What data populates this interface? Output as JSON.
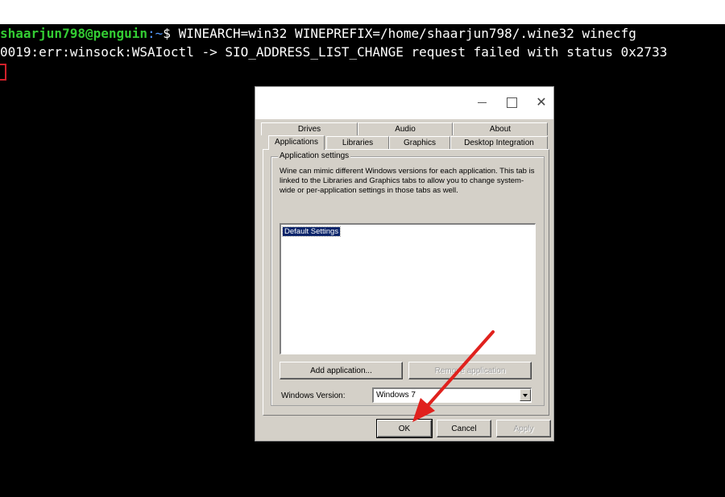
{
  "terminal": {
    "prompt_user": "shaarjun798@penguin",
    "prompt_path": ":~",
    "prompt_symbol": "$ ",
    "command": "WINEARCH=win32 WINEPREFIX=/home/shaarjun798/.wine32 winecfg",
    "output_line": "0019:err:winsock:WSAIoctl -> SIO_ADDRESS_LIST_CHANGE request failed with status 0x2733"
  },
  "dialog": {
    "tabs_row1": [
      "Drives",
      "Audio",
      "About"
    ],
    "tabs_row2": [
      "Applications",
      "Libraries",
      "Graphics",
      "Desktop Integration"
    ],
    "group_title": "Application settings",
    "description": "Wine can mimic different Windows versions for each application. This tab is linked to the Libraries and Graphics tabs to allow you to change system-wide or per-application settings in those tabs as well.",
    "list_items": [
      "Default Settings"
    ],
    "add_button": "Add application...",
    "remove_button": "Remove application",
    "windows_version_label": "Windows Version:",
    "windows_version_value": "Windows 7",
    "ok_button": "OK",
    "cancel_button": "Cancel",
    "apply_button": "Apply"
  },
  "colors": {
    "terminal_bg": "#000000",
    "prompt_user": "#33cc33",
    "prompt_path": "#5599ff",
    "dialog_bg": "#d4d0c8",
    "selection": "#0a246a",
    "annotation_arrow": "#e0211d"
  },
  "icons": {
    "minimize": "minimize-icon",
    "maximize": "maximize-icon",
    "close": "close-icon",
    "dropdown": "chevron-down-icon",
    "annotation": "red-arrow-icon"
  }
}
